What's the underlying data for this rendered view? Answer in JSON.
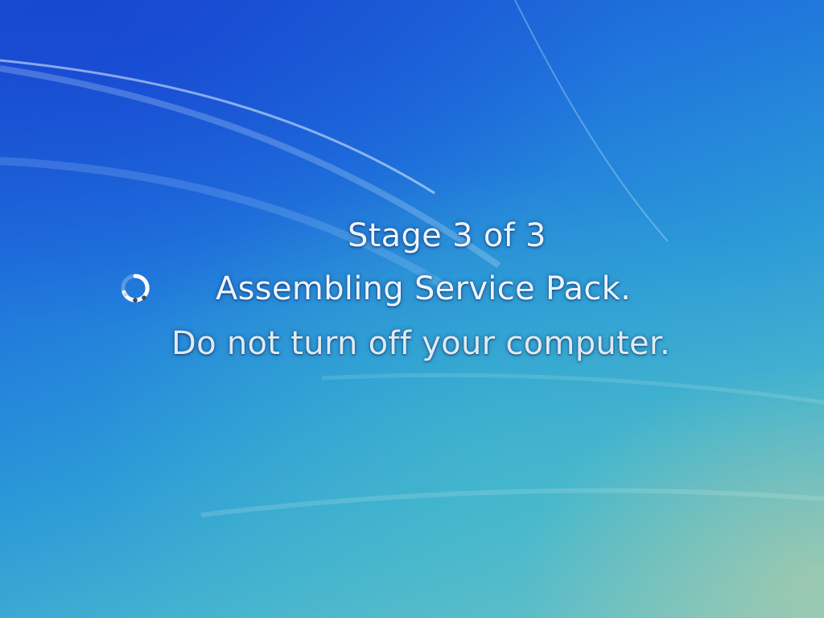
{
  "update_screen": {
    "stage_text": "Stage 3 of 3",
    "status_text": "Assembling Service Pack.",
    "warning_text": "Do not turn off your computer.",
    "spinner_icon": "loading-spinner-icon"
  },
  "colors": {
    "background_top": "#1c4fd0",
    "background_bottom": "#79c6c2",
    "text": "#eef4ff"
  }
}
